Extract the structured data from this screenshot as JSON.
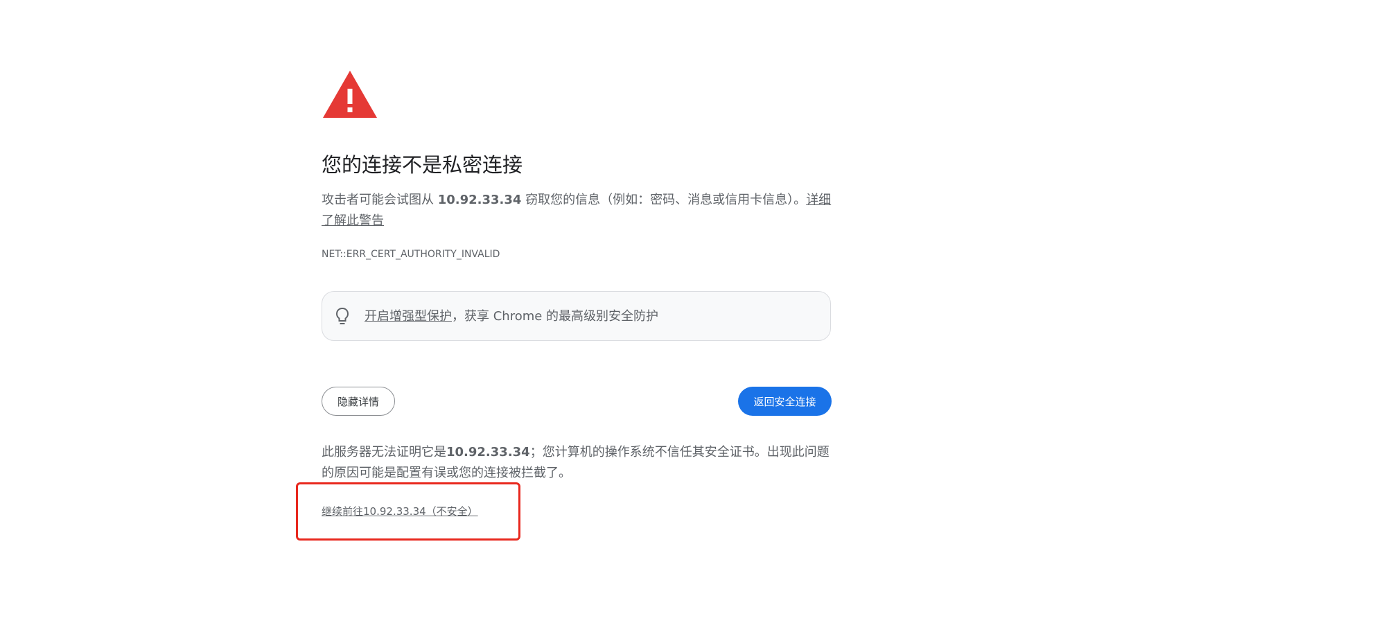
{
  "title": "您的连接不是私密连接",
  "intro": {
    "prefix": "攻击者可能会试图从 ",
    "host": "10.92.33.34",
    "suffix": " 窃取您的信息（例如：密码、消息或信用卡信息）。",
    "learn_more_link": "详细了解此警告"
  },
  "error_code": "NET::ERR_CERT_AUTHORITY_INVALID",
  "promo": {
    "link_text": "开启增强型保护",
    "text": "，获享 Chrome 的最高级别安全防护",
    "icon": "lightbulb-icon"
  },
  "buttons": {
    "hide_details": "隐藏详情",
    "back_to_safety": "返回安全连接"
  },
  "details": {
    "prefix": "此服务器无法证明它是",
    "host": "10.92.33.34",
    "suffix": "；您计算机的操作系统不信任其安全证书。出现此问题的原因可能是配置有误或您的连接被拦截了。"
  },
  "proceed_link": "继续前往10.92.33.34（不安全）",
  "colors": {
    "warning_red": "#e53935",
    "primary_blue": "#1a73e8",
    "text_gray": "#5f6368",
    "highlight_red": "#e8281e"
  }
}
